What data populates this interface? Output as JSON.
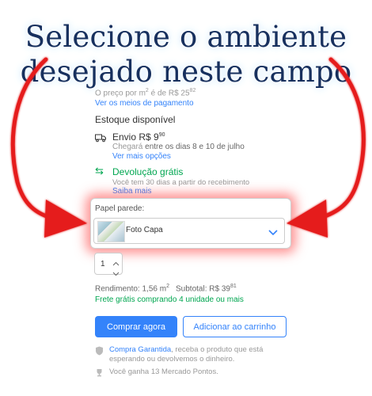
{
  "banner": {
    "line1": "Selecione o ambiente",
    "line2": "desejado neste campo"
  },
  "price_per_m2": "O preço por m",
  "price_per_m2_sup": "2",
  "price_per_m2_mid": "é de R$ 25",
  "price_per_m2_cents": "82",
  "payment_link": "Ver os meios de pagamento",
  "stock": "Estoque disponível",
  "shipping": {
    "label": "Envio R$ 9",
    "cents": "90",
    "arrives_prefix": "Chegará",
    "arrives": "entre os dias 8 e 10 de julho",
    "more_link": "Ver mais opções"
  },
  "returns": {
    "label": "Devolução grátis",
    "desc": "Você tem 30 dias a partir do recebimento",
    "link": "Saiba mais"
  },
  "variant": {
    "label": "Papel parede:",
    "selected": "Foto Capa"
  },
  "quantity": "1",
  "yield": {
    "label": "Rendimento: 1,56 m",
    "sup": "2",
    "subtotal_label": "Subtotal: R$ 39",
    "subtotal_cents": "81"
  },
  "free_shipping": "Frete grátis comprando 4 unidade ou mais",
  "buy_now": "Comprar agora",
  "add_to_cart": "Adicionar ao carrinho",
  "guarantee": {
    "link": "Compra Garantida",
    "text": ", receba o produto que está esperando ou devolvemos o dinheiro."
  },
  "points": "Você ganha 13 Mercado Pontos.",
  "colors": {
    "accent": "#3483fa",
    "green": "#00a650",
    "arrow": "#e51d1d"
  }
}
